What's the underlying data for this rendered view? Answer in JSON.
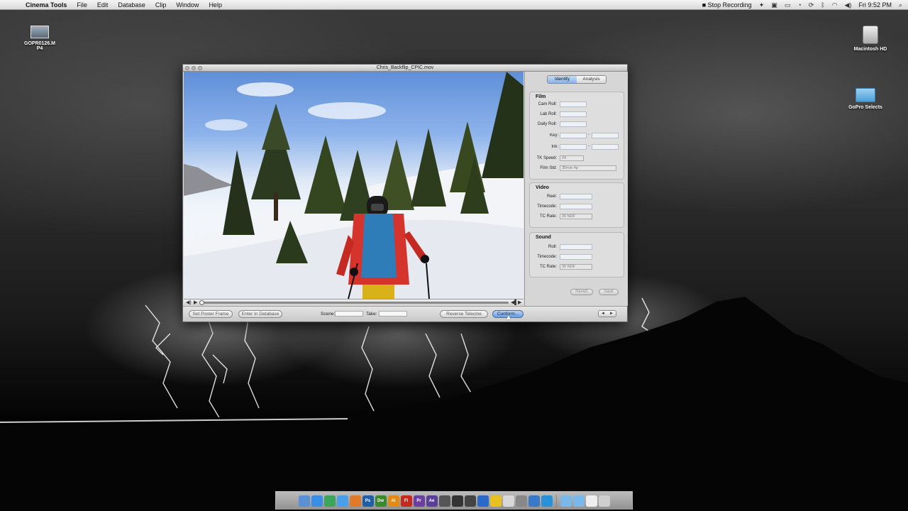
{
  "menubar": {
    "app_name": "Cinema Tools",
    "items": [
      "File",
      "Edit",
      "Database",
      "Clip",
      "Window",
      "Help"
    ],
    "tray": {
      "recording": "Stop Recording",
      "clock": "Fri 9:52 PM"
    }
  },
  "desktop_icons": [
    {
      "label": "GOPR0126.MP4",
      "label_l1": "GOPR0126.M",
      "label_l2": "P4",
      "icon": "video-file-icon"
    },
    {
      "label": "Macintosh HD",
      "icon": "hard-drive-icon"
    },
    {
      "label": "GoPro Selects",
      "icon": "folder-icon"
    }
  ],
  "window": {
    "title": "Chris_Backflip_CPIC.mov",
    "bottom_bar": {
      "set_poster_frame": "Set Poster Frame",
      "enter_in_database": "Enter In Database",
      "scene_label": "Scene:",
      "take_label": "Take:",
      "reverse_telecine": "Reverse Telecine",
      "conform": "Conform..."
    },
    "nav": {
      "prev": "◄",
      "next": "►"
    }
  },
  "panel": {
    "tabs": [
      "Identify",
      "Analysis"
    ],
    "film": {
      "title": "Film",
      "cam_roll": "Cam Roll:",
      "lab_roll": "Lab Roll:",
      "daily_roll": "Daily Roll:",
      "key": "Key:",
      "ink": "Ink:",
      "tk_speed": "TK Speed:",
      "tk_speed_value": "24",
      "film_std": "Film Std:",
      "film_std_value": "35mm 4p"
    },
    "video": {
      "title": "Video",
      "reel": "Reel:",
      "timecode": "Timecode:",
      "tc_rate": "TC Rate:",
      "tc_rate_value": "30 NDF"
    },
    "sound": {
      "title": "Sound",
      "roll": "Roll:",
      "timecode": "Timecode:",
      "tc_rate": "TC Rate:",
      "tc_rate_value": "30 NDF"
    },
    "revert": "Revert",
    "save": "Save"
  },
  "dock": [
    {
      "name": "finder-icon",
      "color": "#5b8fd6",
      "text": ""
    },
    {
      "name": "safari-icon",
      "color": "#3a8ee6",
      "text": ""
    },
    {
      "name": "chrome-icon",
      "color": "#3aa65a",
      "text": ""
    },
    {
      "name": "safari2-icon",
      "color": "#4aa0e8",
      "text": ""
    },
    {
      "name": "firefox-icon",
      "color": "#e07a28",
      "text": ""
    },
    {
      "name": "photoshop-icon",
      "color": "#1e5fa8",
      "text": "Ps"
    },
    {
      "name": "dreamweaver-icon",
      "color": "#3a8a2a",
      "text": "Dw"
    },
    {
      "name": "illustrator-icon",
      "color": "#e38a12",
      "text": "Ai"
    },
    {
      "name": "flash-icon",
      "color": "#c8281e",
      "text": "Fl"
    },
    {
      "name": "premiere-icon",
      "color": "#6a3fa0",
      "text": "Pr"
    },
    {
      "name": "aftereffects-icon",
      "color": "#5a3f9a",
      "text": "Ae"
    },
    {
      "name": "cinema-tools-icon",
      "color": "#555555",
      "text": ""
    },
    {
      "name": "clapper-icon",
      "color": "#333333",
      "text": ""
    },
    {
      "name": "final-cut-icon",
      "color": "#444444",
      "text": ""
    },
    {
      "name": "quicktime-icon",
      "color": "#2a6ac8",
      "text": ""
    },
    {
      "name": "app-icon",
      "color": "#e8c020",
      "text": ""
    },
    {
      "name": "preview-icon",
      "color": "#d8d8d8",
      "text": ""
    },
    {
      "name": "system-prefs-icon",
      "color": "#888888",
      "text": ""
    },
    {
      "name": "utility-icon",
      "color": "#3a78c8",
      "text": ""
    },
    {
      "name": "network-icon",
      "color": "#2a90d8",
      "text": ""
    },
    {
      "name": "folder-docs-icon",
      "color": "#7ab8ea",
      "text": ""
    },
    {
      "name": "folder-downloads-icon",
      "color": "#7ab8ea",
      "text": ""
    },
    {
      "name": "document-icon",
      "color": "#eeeeee",
      "text": ""
    },
    {
      "name": "trash-icon",
      "color": "#cfcfcf",
      "text": ""
    }
  ]
}
